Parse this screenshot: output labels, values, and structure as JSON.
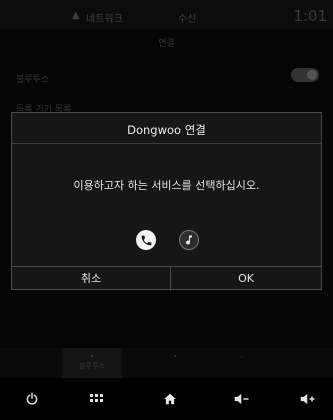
{
  "status_bar": {
    "left_text": "네트워크",
    "center_text": "수신",
    "clock": "1:01"
  },
  "background_page": {
    "title": "연결",
    "rows": [
      {
        "label": "블루투스",
        "right": ""
      },
      {
        "label": "등록 기기 목록",
        "right": ""
      },
      {
        "label": "",
        "right": ""
      },
      {
        "label": "",
        "right": ""
      },
      {
        "label": "",
        "right": ""
      }
    ],
    "bottom_tabs": [
      {
        "label": "블루투스",
        "active": true
      },
      {
        "label": "",
        "active": false
      },
      {
        "label": "",
        "active": false
      }
    ]
  },
  "dialog": {
    "title": "Dongwoo 연결",
    "message": "이용하고자 하는 서비스를 선택하십시오.",
    "services": [
      {
        "icon": "phone-icon",
        "selected": true
      },
      {
        "icon": "music-note-icon",
        "selected": false
      }
    ],
    "cancel_label": "취소",
    "ok_label": "OK"
  },
  "nav_bar": {
    "buttons": [
      "power-icon",
      "apps-grid-icon",
      "home-icon",
      "volume-down-icon",
      "volume-up-icon"
    ]
  },
  "colors": {
    "background": "#000000",
    "dialog_background": "#161616",
    "dialog_border": "#4a4a4a",
    "text": "#ffffff"
  }
}
